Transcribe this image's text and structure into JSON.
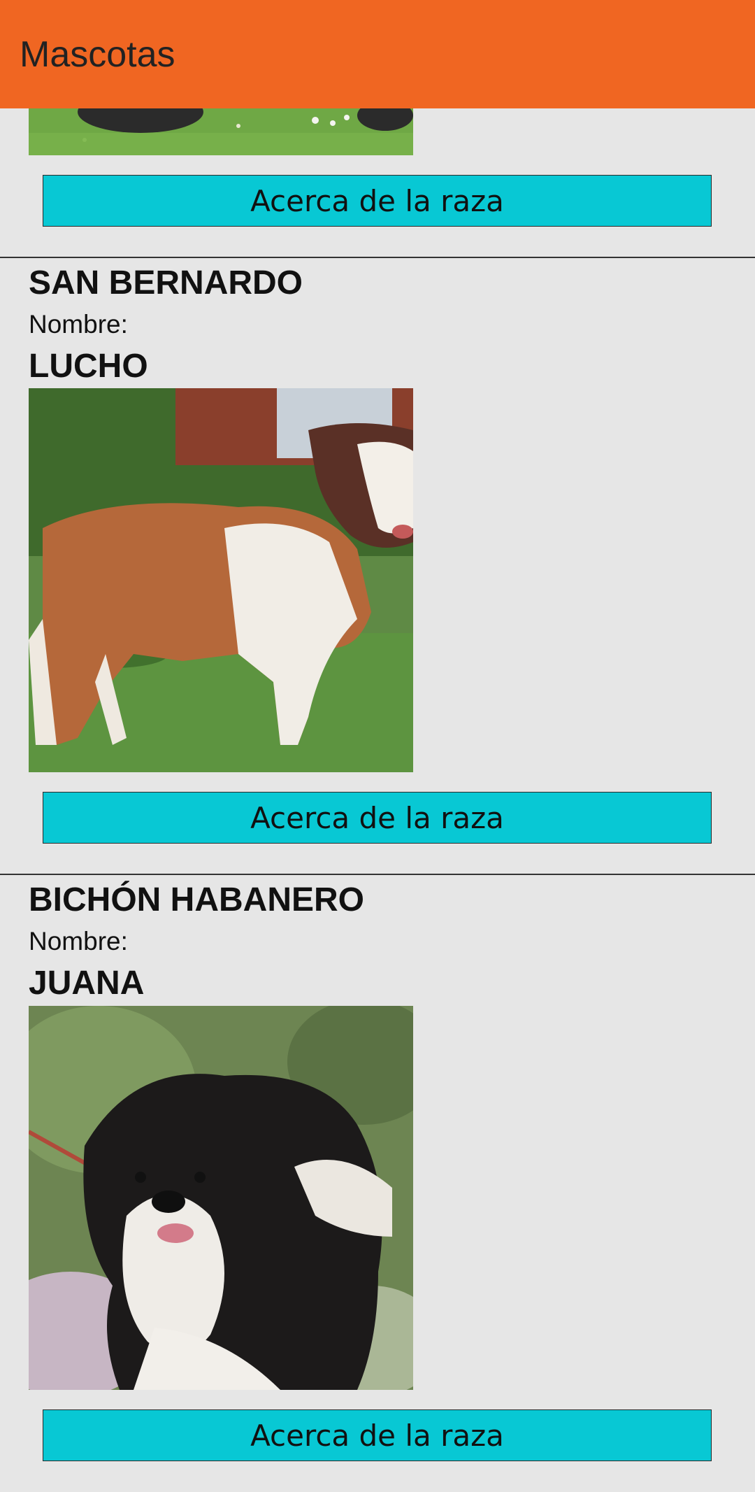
{
  "app_bar": {
    "title": "Mascotas",
    "color": "#f06622"
  },
  "cards": [
    {
      "breed": "",
      "name_label": "",
      "name": "",
      "button_label": "Acerca de la raza",
      "photo": "dog-on-grass-photo"
    },
    {
      "breed": "SAN BERNARDO",
      "name_label": "Nombre:",
      "name": "LUCHO",
      "button_label": "Acerca de la raza",
      "photo": "saint-bernard-photo"
    },
    {
      "breed": "BICHÓN HABANERO",
      "name_label": "Nombre:",
      "name": "JUANA",
      "button_label": "Acerca de la raza",
      "photo": "havanese-photo"
    }
  ],
  "colors": {
    "accent_button": "#08c8d4",
    "background": "#e6e6e6"
  }
}
